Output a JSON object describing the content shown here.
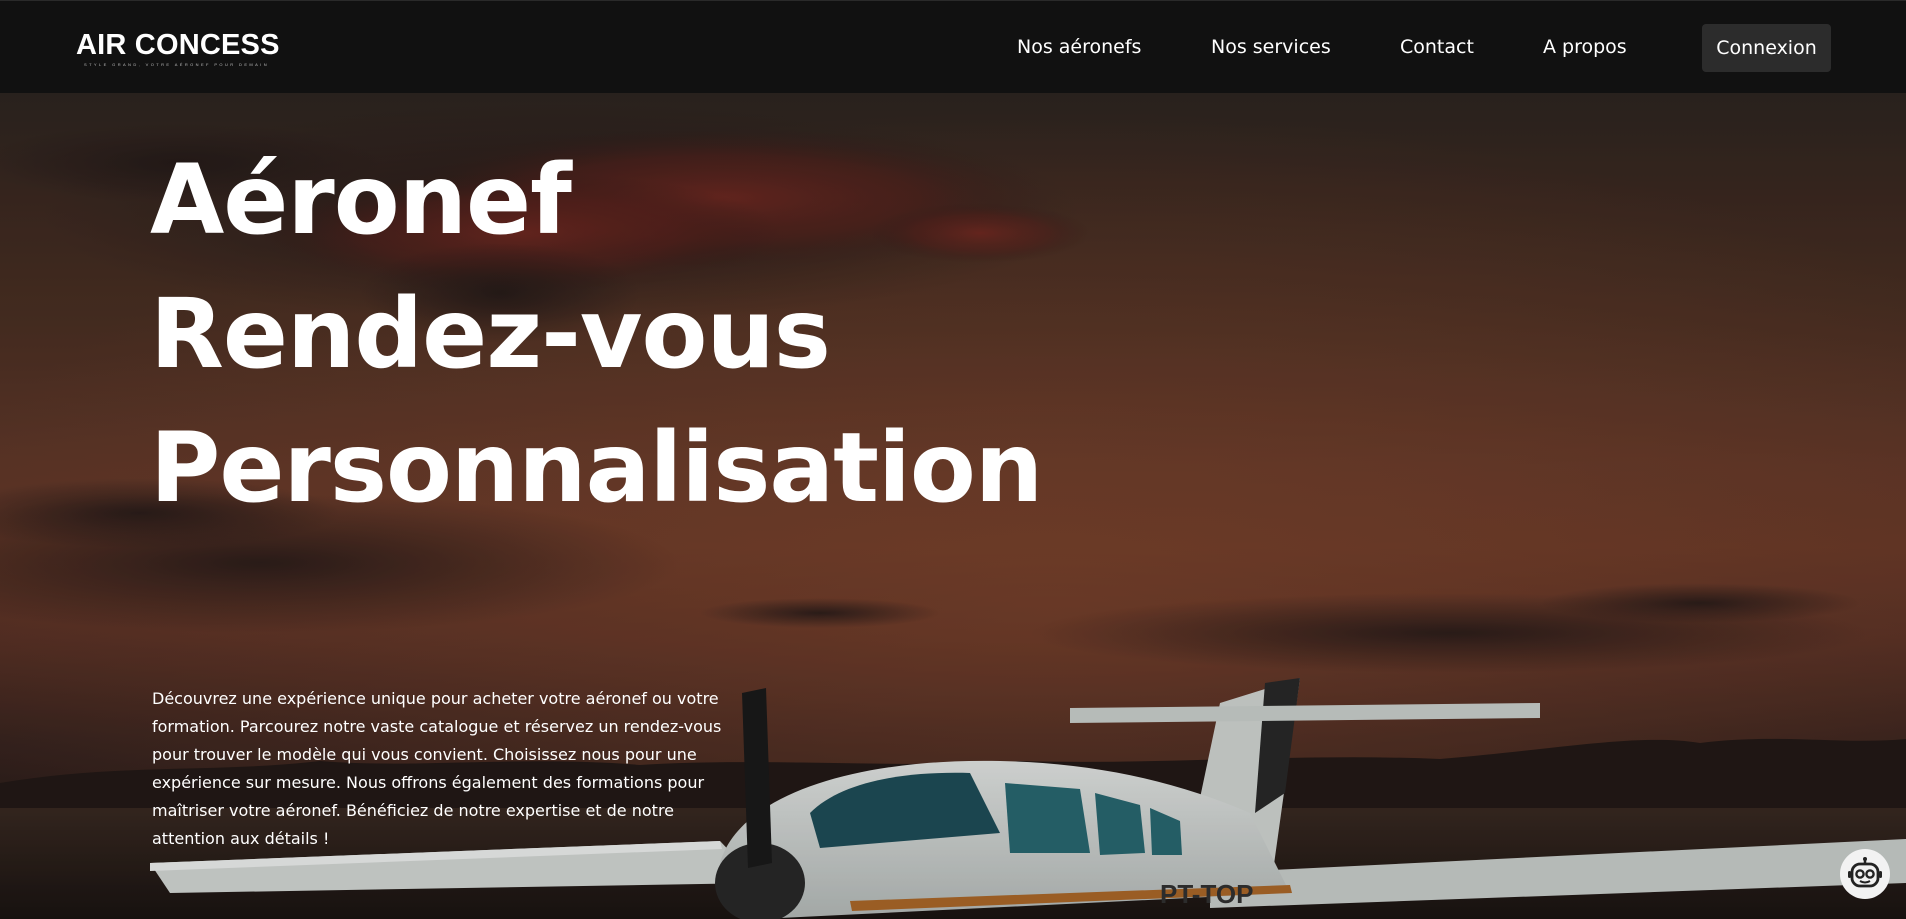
{
  "brand": {
    "name": "AIR CONCESS",
    "tagline": "STYLE GRAND, VOTRE AÉRONEF POUR DEMAIN"
  },
  "nav": {
    "links": [
      {
        "label": "Nos aéronefs"
      },
      {
        "label": "Nos services"
      },
      {
        "label": "Contact"
      },
      {
        "label": "A propos"
      }
    ],
    "login_label": "Connexion"
  },
  "hero": {
    "lines": [
      "Aéronef",
      "Rendez-vous",
      "Personnalisation"
    ],
    "description": "Découvrez une expérience unique pour acheter votre aéronef ou votre formation. Parcourez notre vaste catalogue et réservez un rendez-vous pour trouver le modèle qui vous convient. Choisissez nous pour une expérience sur mesure. Nous offrons également des formations pour maîtriser votre aéronef. Bénéficiez de notre expertise et de notre attention aux détails !",
    "background_image": "plane-on-runway-at-sunset"
  },
  "chatbot": {
    "icon": "robot-icon"
  },
  "colors": {
    "navbar_bg": "#111111",
    "login_button_bg": "#2c2c2c",
    "text": "#ffffff"
  }
}
